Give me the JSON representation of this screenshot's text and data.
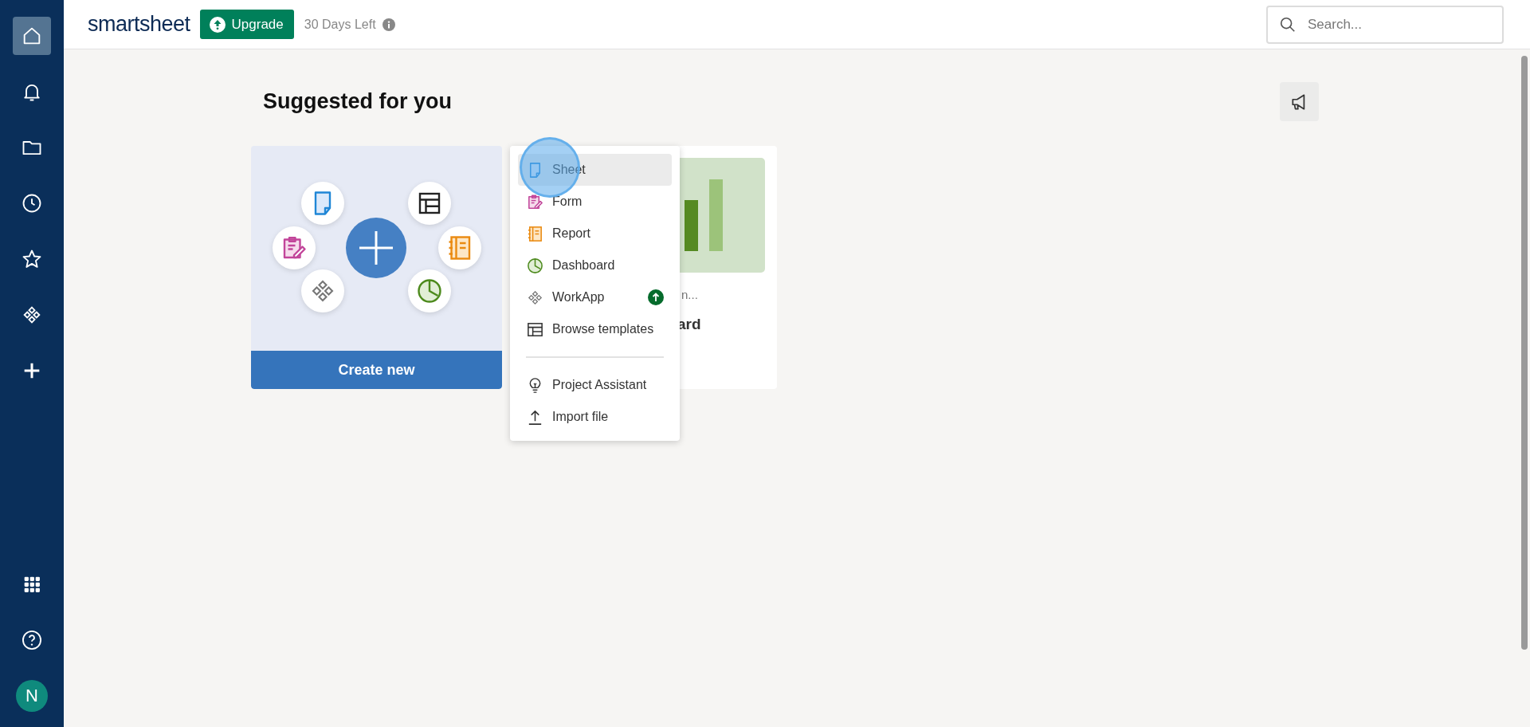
{
  "sidebar": {
    "items": [
      {
        "kind": "home",
        "selected": true
      },
      {
        "kind": "bell",
        "selected": false
      },
      {
        "kind": "folder",
        "selected": false
      },
      {
        "kind": "clock",
        "selected": false
      },
      {
        "kind": "star",
        "selected": false
      },
      {
        "kind": "workapp",
        "selected": false
      },
      {
        "kind": "plus",
        "selected": false
      }
    ],
    "bottom_items": [
      {
        "kind": "apps",
        "selected": false
      },
      {
        "kind": "help",
        "selected": false
      }
    ],
    "avatar": {
      "initial": "N"
    }
  },
  "header": {
    "logo": "smartsheet",
    "upgrade_button": "Upgrade",
    "trial_status": "30 Days Left",
    "search": {
      "placeholder": "Search..."
    }
  },
  "main": {
    "title": "Suggested for you",
    "create_card": {
      "button": "Create new"
    },
    "suggested_card": {
      "subtitle": "n...",
      "title": "ard"
    },
    "create_menu": {
      "groups": [
        [
          {
            "kind": "sheet",
            "label": "Sheet",
            "selected": true,
            "upgrade": false
          },
          {
            "kind": "form",
            "label": "Form",
            "selected": false,
            "upgrade": false
          },
          {
            "kind": "report",
            "label": "Report",
            "selected": false,
            "upgrade": false
          },
          {
            "kind": "dashboard",
            "label": "Dashboard",
            "selected": false,
            "upgrade": false
          },
          {
            "kind": "workapp",
            "label": "WorkApp",
            "selected": false,
            "upgrade": true
          },
          {
            "kind": "templates",
            "label": "Browse templates",
            "selected": false,
            "upgrade": false
          }
        ],
        [
          {
            "kind": "assistant",
            "label": "Project Assistant",
            "selected": false,
            "upgrade": false
          },
          {
            "kind": "import",
            "label": "Import file",
            "selected": false,
            "upgrade": false
          }
        ]
      ]
    }
  }
}
